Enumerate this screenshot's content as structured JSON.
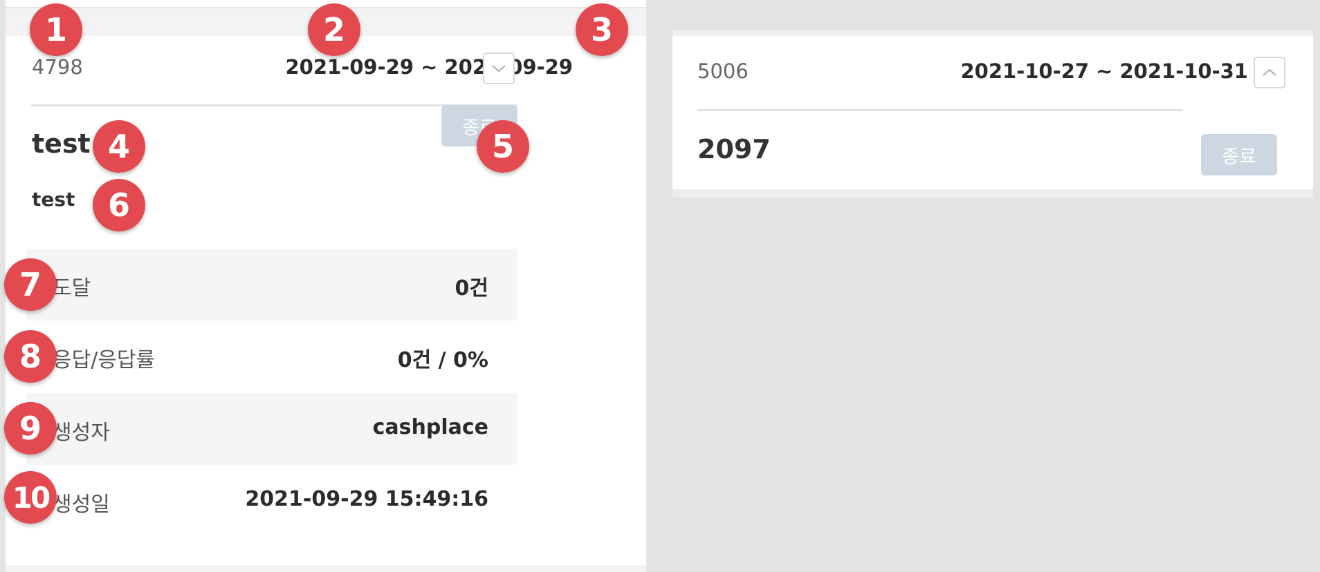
{
  "left_card": {
    "id": "4798",
    "date_range": "2021-09-29 ~ 2021-09-29",
    "toggle_icon": "chevron-down-icon",
    "title": "test",
    "end_button": "종료",
    "description": "test",
    "stats": [
      {
        "label": "도달",
        "value": "0건"
      },
      {
        "label": "응답/응답률",
        "value": "0건 / 0%"
      },
      {
        "label": "생성자",
        "value": "cashplace"
      },
      {
        "label": "생성일",
        "value": "2021-09-29 15:49:16"
      }
    ]
  },
  "right_card": {
    "id": "5006",
    "date_range": "2021-10-27 ~ 2021-10-31",
    "toggle_icon": "chevron-up-icon",
    "title": "2097",
    "end_button": "종료"
  },
  "annotations": [
    "1",
    "2",
    "3",
    "4",
    "5",
    "6",
    "7",
    "8",
    "9",
    "10"
  ],
  "colors": {
    "badge": "#e24a4f",
    "end_button_bg": "#ccd7e1",
    "row_shade": "#f5f5f5",
    "page_bg": "#e4e4e4"
  }
}
